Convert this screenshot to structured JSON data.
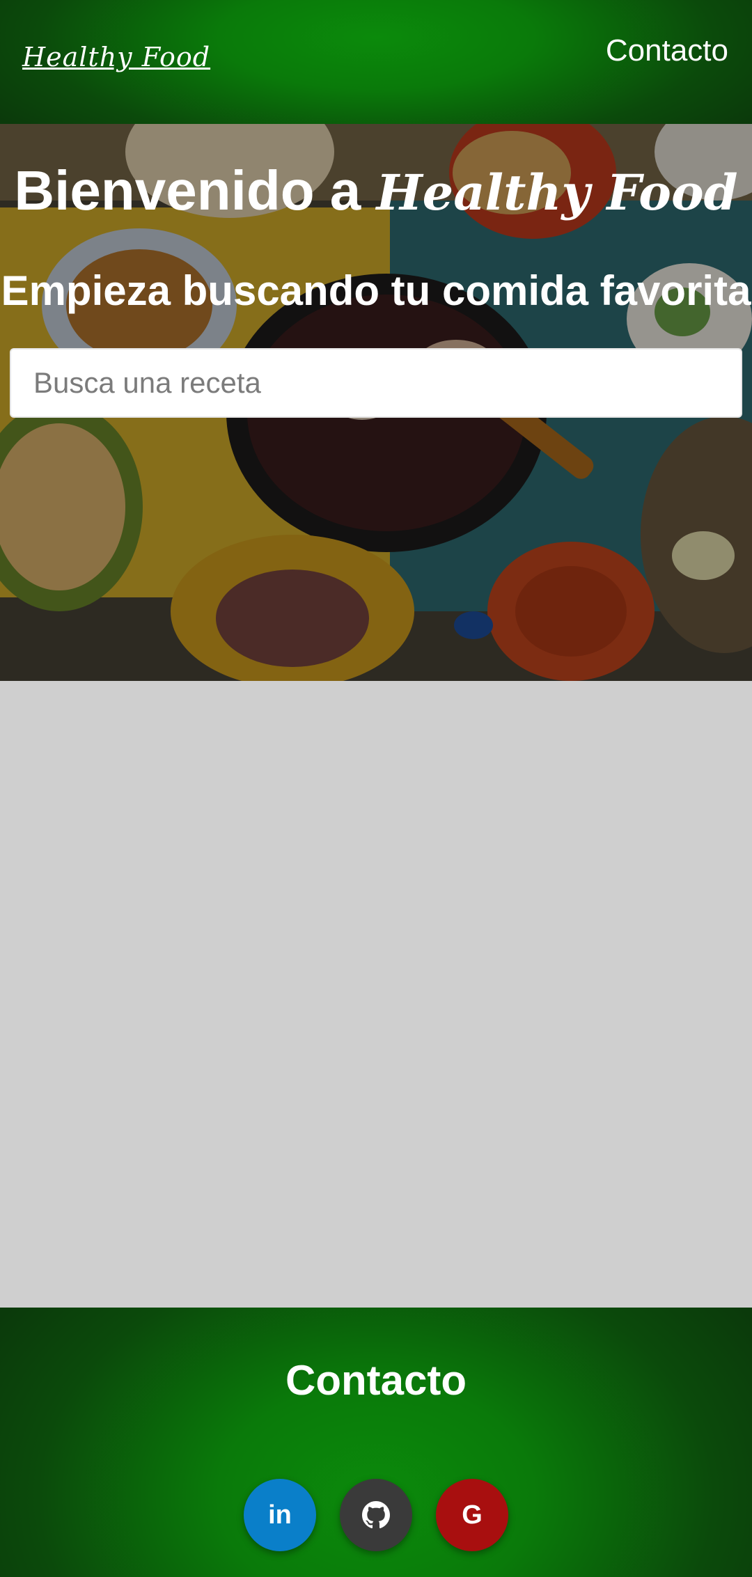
{
  "navbar": {
    "brand": "Healthy Food",
    "contact_link": "Contacto"
  },
  "hero": {
    "title_prefix": "Bienvenido a",
    "title_script": "Healthy Food",
    "subtitle": "Empieza buscando tu comida favorita",
    "search_placeholder": "Busca una receta",
    "search_value": ""
  },
  "footer": {
    "title": "Contacto",
    "social": [
      {
        "label": "in",
        "icon": "linkedin-icon",
        "color": "#0a7fc9"
      },
      {
        "label": "",
        "icon": "github-icon",
        "color": "#3a3a3a"
      },
      {
        "label": "G",
        "icon": "google-icon",
        "color": "#a80f0f"
      }
    ]
  },
  "colors": {
    "primary_green": "#0a7a0a",
    "content_background": "#cfcfcf"
  }
}
